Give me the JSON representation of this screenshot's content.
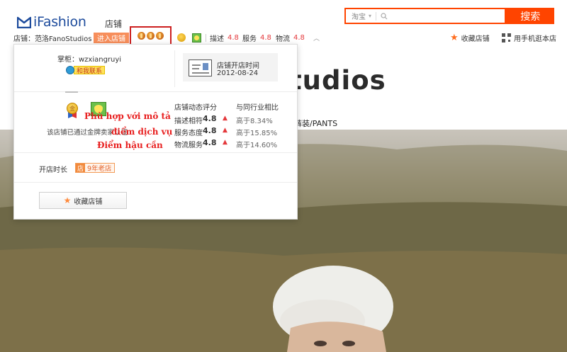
{
  "header": {
    "brand": "iFashion",
    "tab": "店铺",
    "search": {
      "scope": "淘宝",
      "placeholder": "",
      "button": "搜索"
    }
  },
  "shop_bar": {
    "shop_name": "店铺：范洛FanoStudios",
    "enter_button": "进入店铺",
    "ratings": [
      {
        "label": "描述",
        "score": "4.8"
      },
      {
        "label": "服务",
        "score": "4.8"
      },
      {
        "label": "物流",
        "score": "4.8"
      }
    ],
    "collect": "收藏店铺",
    "mobile": "用手机逛本店"
  },
  "hero": {
    "title": "tudios",
    "nav_fragment": "裤装/PANTS"
  },
  "popup": {
    "seller": "掌柜：wzxiangruyi",
    "contact": "和我联系",
    "since_label": "店铺开店时间",
    "since_date": "2012-08-24",
    "cert_text": "该店铺已通过金牌卖家认证",
    "rating_title": "店铺动态评分",
    "compare_title": "与同行业相比",
    "rating_rows": [
      {
        "label": "描述相符",
        "score": "4.8",
        "compare": "高于8.34%"
      },
      {
        "label": "服务态度",
        "score": "4.8",
        "compare": "高于15.85%"
      },
      {
        "label": "物流服务",
        "score": "4.8",
        "compare": "高于14.60%"
      }
    ],
    "open_label": "开店时长",
    "open_badge_icon": "店",
    "open_badge_text": "9年老店",
    "fav_button": "收藏店铺"
  },
  "annotations": [
    "Phù hợp với mô tả",
    "điểm dịch vụ",
    "Điểm hậu cần"
  ],
  "colors": {
    "accent": "#ff4400",
    "brand": "#1d4b9c",
    "score": "#e4393c",
    "overlay": "#e81f1f"
  }
}
